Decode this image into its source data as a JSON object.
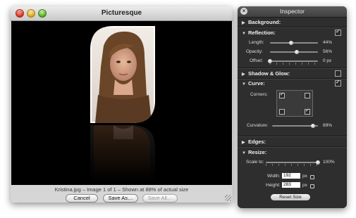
{
  "window": {
    "title": "Picturesque",
    "status": "Kristina.jpg – Image 1 of 1 – Shown at 88% of actual size",
    "buttons": {
      "cancel": "Cancel",
      "save_as": "Save As…",
      "save_all": "Save All…"
    }
  },
  "inspector": {
    "title": "Inspector",
    "sections": {
      "background": "Background:",
      "reflection": "Reflection:",
      "shadow_glow": "Shadow & Glow:",
      "curve": "Curve:",
      "edges": "Edges:",
      "resize": "Resize:"
    },
    "reflection": {
      "length_label": "Length:",
      "length_value": "44%",
      "length_level": 0.44,
      "opacity_label": "Opacity:",
      "opacity_value": "56%",
      "opacity_level": 0.56,
      "offset_label": "Offset:",
      "offset_value": "0 px",
      "offset_level": 0.0,
      "enabled": true
    },
    "shadow_glow_enabled": false,
    "curve": {
      "enabled": true,
      "corners_label": "Corners:",
      "corners": {
        "top_left": true,
        "top_right": false,
        "bottom_left": false,
        "bottom_right": true
      },
      "curvature_label": "Curvature:",
      "curvature_value": "89%",
      "curvature_level": 0.89
    },
    "resize": {
      "scale_label": "Scale to:",
      "scale_value": "100%",
      "scale_level": 1.0,
      "width_label": "Width:",
      "width_value": "192",
      "width_unit": "px",
      "height_label": "Height:",
      "height_value": "283",
      "height_unit": "px",
      "reset_label": "Reset Size"
    }
  },
  "icons": [
    "close-icon",
    "disclosure-triangle-icon",
    "lock-icon",
    "resize-grip-icon"
  ]
}
